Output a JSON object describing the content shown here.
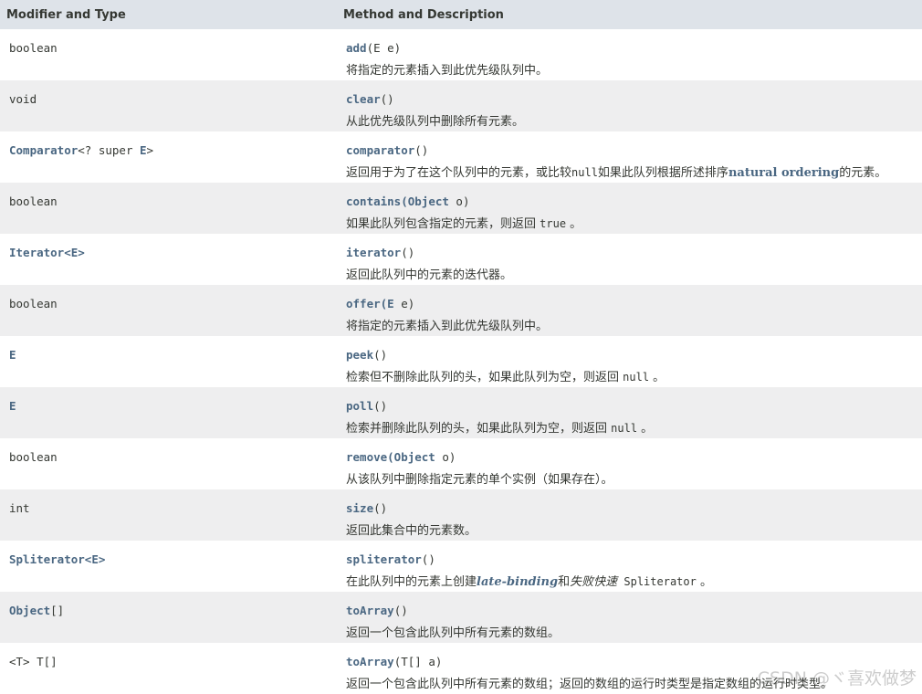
{
  "header": {
    "col1": "Modifier and Type",
    "col2": "Method and Description"
  },
  "rows": [
    {
      "type": "boolean",
      "method": "add",
      "params": "(E e)",
      "desc": "将指定的元素插入到此优先级队列中。"
    },
    {
      "type": "void",
      "method": "clear",
      "params": "()",
      "desc": "从此优先级队列中删除所有元素。"
    },
    {
      "type_link": "Comparator",
      "type_rest": "<? super ",
      "type_link2": "E",
      "type_end": ">",
      "method": "comparator",
      "params": "()",
      "desc_a": "返回用于为了在这个队列中的元素，或比较",
      "desc_code": "null",
      "desc_b": "如果此队列根据所述排序",
      "desc_link": "natural ordering",
      "desc_c": "的元素。"
    },
    {
      "type": "boolean",
      "method": "contains",
      "params_link": "(Object",
      "params_rest": " o)",
      "desc_a": "如果此队列包含指定的元素，则返回 ",
      "desc_code": "true",
      "desc_c": " 。"
    },
    {
      "type_link": "Iterator",
      "type_rest": "<E>",
      "method": "iterator",
      "params": "()",
      "desc": "返回此队列中的元素的迭代器。"
    },
    {
      "type": "boolean",
      "method": "offer",
      "params_link": "(E",
      "params_rest": " e)",
      "desc": "将指定的元素插入到此优先级队列中。"
    },
    {
      "type_link": "E",
      "method": "peek",
      "params": "()",
      "desc_a": "检索但不删除此队列的头，如果此队列为空，则返回 ",
      "desc_code": "null",
      "desc_c": " 。"
    },
    {
      "type_link": "E",
      "method": "poll",
      "params": "()",
      "desc_a": "检索并删除此队列的头，如果此队列为空，则返回 ",
      "desc_code": "null",
      "desc_c": " 。"
    },
    {
      "type": "boolean",
      "method": "remove",
      "params_link": "(Object",
      "params_rest": " o)",
      "desc": "从该队列中删除指定元素的单个实例（如果存在）。"
    },
    {
      "type": "int",
      "method": "size",
      "params": "()",
      "desc": "返回此集合中的元素数。"
    },
    {
      "type_link": "Spliterator",
      "type_rest": "<E>",
      "method": "spliterator",
      "params": "()",
      "desc_a": "在此队列中的元素上创建",
      "desc_link": "late-binding",
      "desc_b": "和",
      "desc_italic": "失败快速",
      "desc_code": " Spliterator",
      "desc_c": " 。"
    },
    {
      "type_link": "Object",
      "type_rest": "[]",
      "method": "toArray",
      "params": "()",
      "desc": "返回一个包含此队列中所有元素的数组。"
    },
    {
      "type": "<T> T[]",
      "method": "toArray",
      "params": "(T[] a)",
      "desc": "返回一个包含此队列中所有元素的数组；返回的数组的运行时类型是指定数组的运行时类型。"
    }
  ],
  "watermark": "CSDN @ヾ喜欢做梦"
}
